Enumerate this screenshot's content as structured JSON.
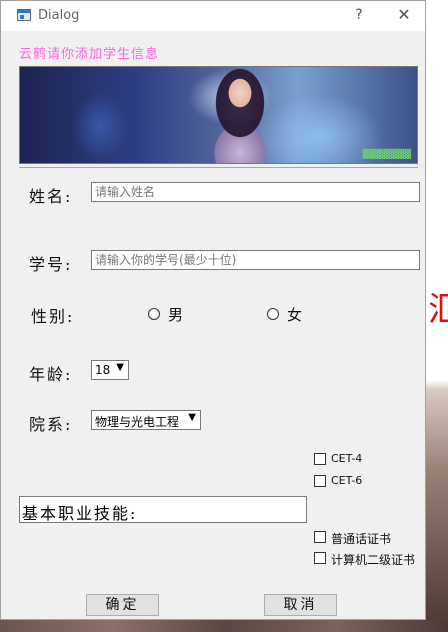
{
  "window": {
    "title": "Dialog",
    "help_glyph": "?",
    "close_glyph": "✕"
  },
  "banner": {
    "title": "云鹤请你添加学生信息",
    "watermark": "▓▓▓▓▓▓▓"
  },
  "form": {
    "name_label": "姓名:",
    "name_placeholder": "请输入姓名",
    "id_label": "学号:",
    "id_placeholder": "请输入你的学号(最少十位)",
    "gender_label": "性别:",
    "gender_male": "男",
    "gender_female": "女",
    "age_label": "年龄:",
    "age_value": "18",
    "dept_label": "院系:",
    "dept_value": "物理与光电工程",
    "skills_label": "基本职业技能:",
    "cet4": "CET-4",
    "cet6": "CET-6",
    "mandarin": "普通话证书",
    "computer": "计算机二级证书",
    "arrow_glyph": "▼"
  },
  "buttons": {
    "ok": "确定",
    "cancel": "取消"
  },
  "background": {
    "glyph": "汇"
  }
}
